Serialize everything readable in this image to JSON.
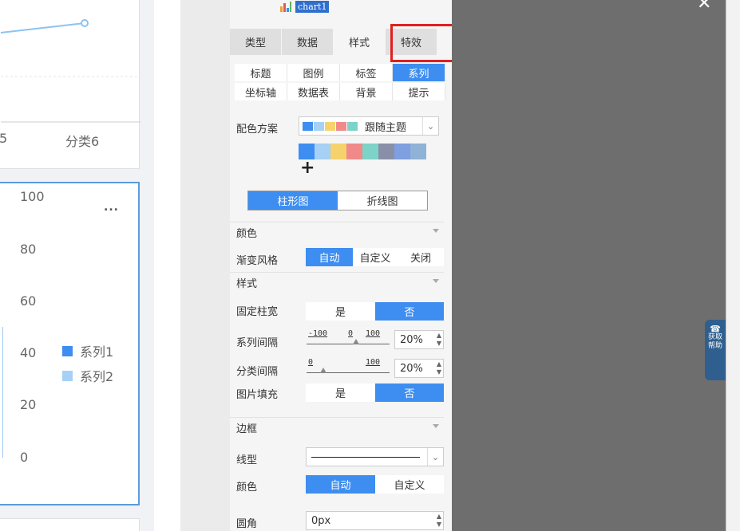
{
  "chart_preview": {
    "top_chart": {
      "x_labels": [
        "5",
        "分类6"
      ]
    },
    "bottom_chart": {
      "y_ticks": [
        "100",
        "80",
        "60",
        "40",
        "20",
        "0"
      ],
      "more_label": "...",
      "legend": [
        {
          "name": "系列1",
          "color": "#3d8ef0"
        },
        {
          "name": "系列2",
          "color": "#a6d0f5"
        }
      ]
    }
  },
  "panel": {
    "chart_name": "chart1",
    "main_tabs": [
      {
        "label": "类型",
        "active": false
      },
      {
        "label": "数据",
        "active": false
      },
      {
        "label": "样式",
        "active": true
      },
      {
        "label": "特效",
        "active": false
      }
    ],
    "sub_tabs_row1": [
      {
        "label": "标题",
        "active": false
      },
      {
        "label": "图例",
        "active": false
      },
      {
        "label": "标签",
        "active": false
      },
      {
        "label": "系列",
        "active": true
      }
    ],
    "sub_tabs_row2": [
      {
        "label": "坐标轴",
        "active": false
      },
      {
        "label": "数据表",
        "active": false
      },
      {
        "label": "背景",
        "active": false
      },
      {
        "label": "提示",
        "active": false
      }
    ],
    "color_scheme": {
      "label": "配色方案",
      "value": "跟随主题",
      "swatches": [
        "#3d8ef0",
        "#a6d0f5",
        "#f5d26b",
        "#f08a8a",
        "#7dd3c7",
        "#8a8fa8",
        "#7e9fe0",
        "#8fb2d6"
      ],
      "add_symbol": "+"
    },
    "chart_type_toggle": [
      {
        "label": "柱形图",
        "active": true
      },
      {
        "label": "折线图",
        "active": false
      }
    ],
    "section_color": {
      "title": "颜色",
      "gradient_label": "渐变风格",
      "gradient_options": [
        {
          "label": "自动",
          "active": true
        },
        {
          "label": "自定义",
          "active": false
        },
        {
          "label": "关闭",
          "active": false
        }
      ]
    },
    "section_style": {
      "title": "样式",
      "fixed_width_label": "固定柱宽",
      "fixed_width_options": [
        {
          "label": "是",
          "active": false
        },
        {
          "label": "否",
          "active": true
        }
      ],
      "series_gap": {
        "label": "系列间隔",
        "tick_min": "-100",
        "tick_mid": "0",
        "tick_max": "100",
        "value": "20%",
        "slider_fraction": 0.6
      },
      "category_gap": {
        "label": "分类间隔",
        "tick_min": "0",
        "tick_max": "100",
        "value": "20%",
        "slider_fraction": 0.2
      },
      "image_fill_label": "图片填充",
      "image_fill_options": [
        {
          "label": "是",
          "active": false
        },
        {
          "label": "否",
          "active": true
        }
      ]
    },
    "section_border": {
      "title": "边框",
      "line_type_label": "线型",
      "color_label": "颜色",
      "color_options": [
        {
          "label": "自动",
          "active": true
        },
        {
          "label": "自定义",
          "active": false
        }
      ],
      "radius_label": "圆角",
      "radius_value": "0px"
    }
  },
  "overlay": {
    "close_symbol": "✕",
    "help_text_1": "获取",
    "help_text_2": "帮助"
  }
}
